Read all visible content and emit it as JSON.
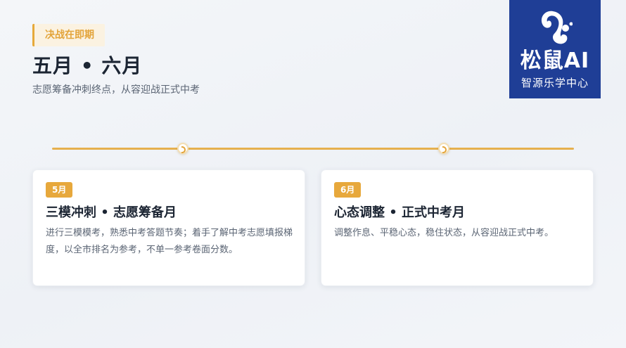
{
  "header": {
    "tag": "决战在即期",
    "title": "五月 • 六月",
    "subtitle": "志愿筹备冲刺终点，从容迎战正式中考"
  },
  "logo": {
    "brand": "松鼠AI",
    "sub": "智源乐学中心"
  },
  "cards": [
    {
      "badge": "5月",
      "title": "三模冲刺 • 志愿筹备月",
      "desc": "进行三模模考，熟悉中考答题节奏；着手了解中考志愿填报梯度，以全市排名为参考，不单一参考卷面分数。"
    },
    {
      "badge": "6月",
      "title": "心态调整 • 正式中考月",
      "desc": "调整作息、平稳心态，稳住状态，从容迎战正式中考。"
    }
  ],
  "colors": {
    "accent": "#e6a93a",
    "logo_bg": "#1f3e96",
    "title": "#1c2533",
    "muted": "#5b6574"
  }
}
